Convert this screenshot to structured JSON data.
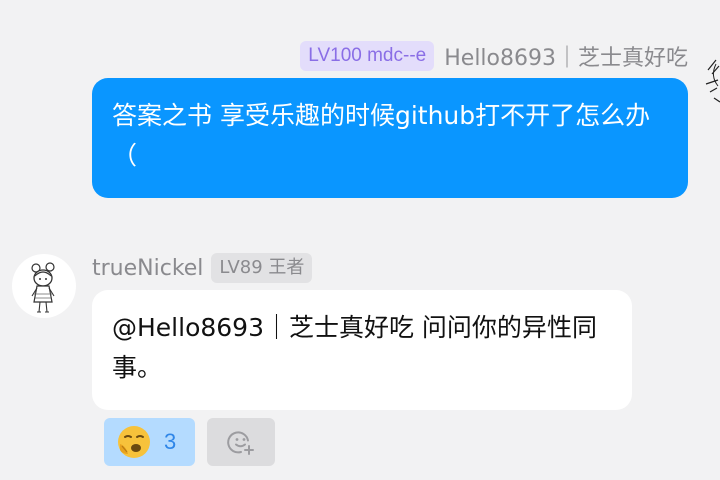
{
  "messages": [
    {
      "badge": "LV100 mdc--e",
      "sender": "Hello8693｜芝士真好吃",
      "text": "答案之书 享受乐趣的时候github打不开了怎么办（",
      "side": "right"
    },
    {
      "badge": "LV89 王者",
      "sender": "trueNickel",
      "text": "@Hello8693｜芝士真好吃 问问你的异性同事。",
      "side": "left"
    }
  ],
  "reactions": [
    {
      "emoji": "yawning-face-icon",
      "count": "3"
    }
  ],
  "add_reaction_icon": "add-emoji-icon",
  "colors": {
    "background": "#f2f2f3",
    "own_bubble": "#0a96ff",
    "other_bubble": "#ffffff",
    "badge_purple_bg": "#e3ddfb",
    "badge_purple_text": "#8a6ee6",
    "badge_grey_bg": "#e2e2e4",
    "reaction_bg": "#b4dbff",
    "reaction_text": "#2f86e8"
  }
}
